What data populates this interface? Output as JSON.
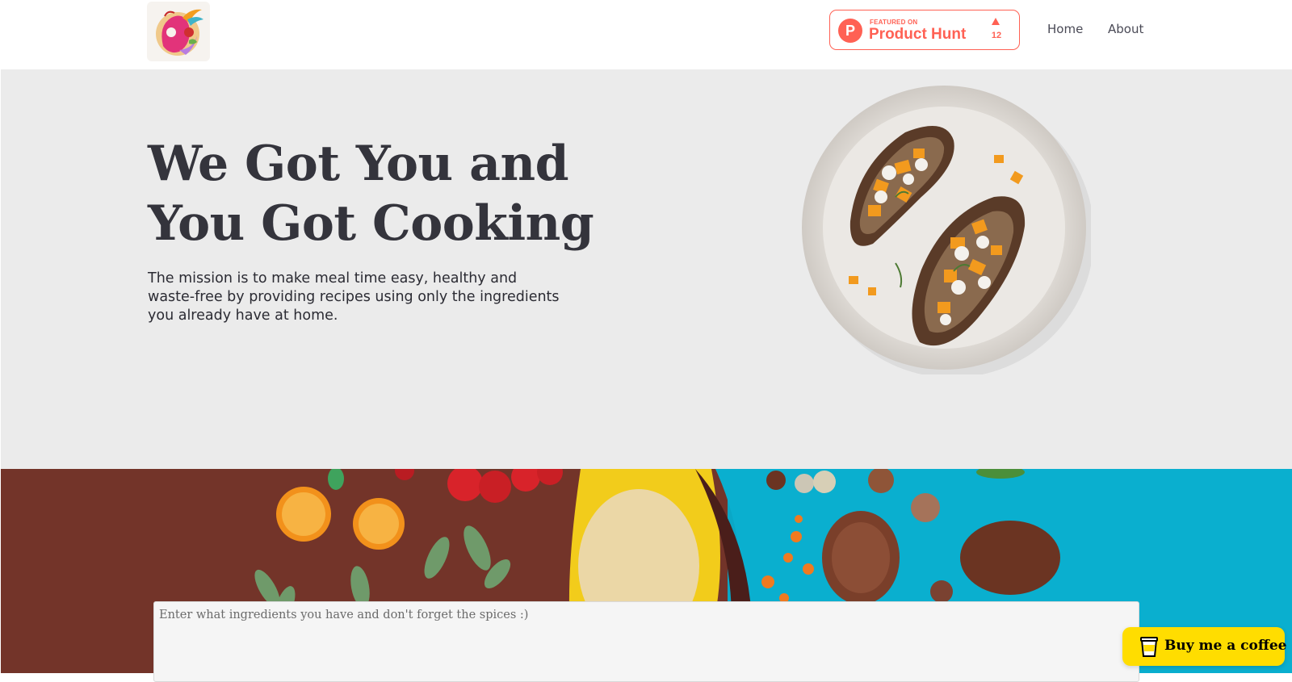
{
  "header": {
    "logo_icon": "rainbow-bird-logo-icon",
    "product_hunt": {
      "featured_label": "FEATURED ON",
      "name": "Product Hunt",
      "letter": "P",
      "upvotes": "12",
      "color": "#ff6154"
    },
    "nav": [
      {
        "label": "Home"
      },
      {
        "label": "About"
      }
    ]
  },
  "hero": {
    "title_line1": "We Got You and",
    "title_line2": "You Got Cooking",
    "description": "The mission is to make meal time easy, healthy and waste-free by providing recipes using only the ingredients you already have at home.",
    "image_icon": "plate-with-toast-icon"
  },
  "ingredients": {
    "placeholder": "Enter what ingredients you have and don't forget the spices :)",
    "value": ""
  },
  "coffee_button": {
    "label": "Buy me a coffee",
    "icon": "coffee-cup-icon",
    "color": "#ffdd00"
  }
}
